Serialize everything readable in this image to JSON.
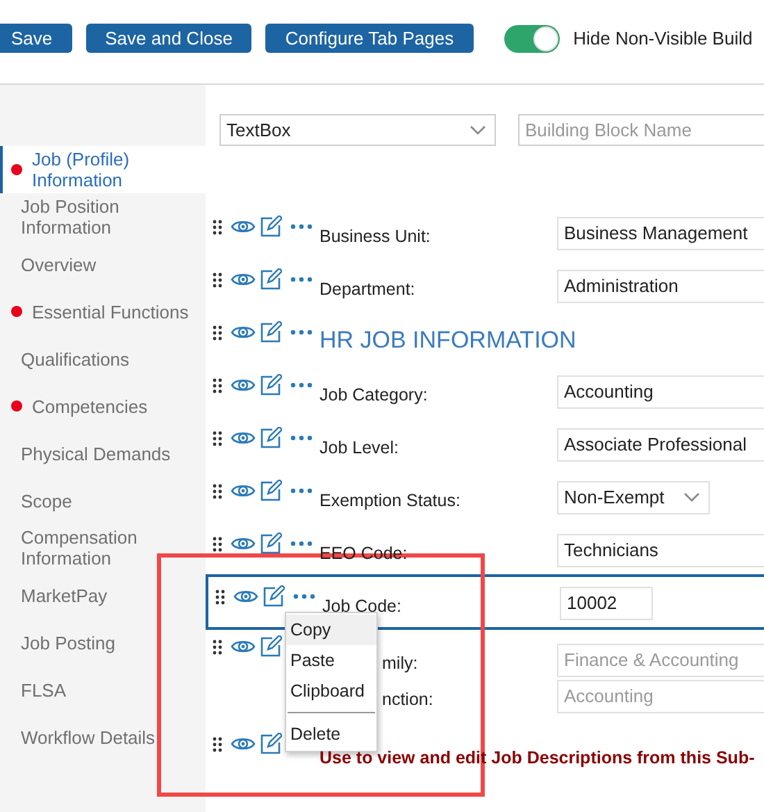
{
  "toolbar": {
    "buttons": [
      "Save",
      "Save and Close",
      "Configure Tab Pages"
    ],
    "toggle": {
      "on": true,
      "label": "Hide Non-Visible Build"
    }
  },
  "sidebar": {
    "items": [
      {
        "label": "Job (Profile) Information",
        "flagged": true,
        "selected": true
      },
      {
        "label": "Job Position Information",
        "flagged": false,
        "selected": false
      },
      {
        "label": "Overview",
        "flagged": false,
        "selected": false
      },
      {
        "label": "Essential Functions",
        "flagged": true,
        "selected": false
      },
      {
        "label": "Qualifications",
        "flagged": false,
        "selected": false
      },
      {
        "label": "Competencies",
        "flagged": true,
        "selected": false
      },
      {
        "label": "Physical Demands",
        "flagged": false,
        "selected": false
      },
      {
        "label": "Scope",
        "flagged": false,
        "selected": false
      },
      {
        "label": "Compensation Information",
        "flagged": false,
        "selected": false
      },
      {
        "label": "MarketPay",
        "flagged": false,
        "selected": false
      },
      {
        "label": "Job Posting",
        "flagged": false,
        "selected": false
      },
      {
        "label": "FLSA",
        "flagged": false,
        "selected": false
      },
      {
        "label": "Workflow Details",
        "flagged": false,
        "selected": false
      }
    ]
  },
  "filters": {
    "type_select": {
      "value": "TextBox"
    },
    "name_field": {
      "placeholder": "Building Block Name"
    }
  },
  "rows": [
    {
      "kind": "field",
      "selected": false,
      "fields": [
        {
          "label": "Business Unit:",
          "value": "Business Management",
          "kind": "textbox",
          "disabled": false
        }
      ]
    },
    {
      "kind": "field",
      "selected": false,
      "fields": [
        {
          "label": "Department:",
          "value": "Administration",
          "kind": "textbox",
          "disabled": false
        }
      ]
    },
    {
      "kind": "heading",
      "selected": false,
      "text": "HR JOB INFORMATION"
    },
    {
      "kind": "field",
      "selected": false,
      "fields": [
        {
          "label": "Job Category:",
          "value": "Accounting",
          "kind": "textbox",
          "disabled": false
        }
      ]
    },
    {
      "kind": "field",
      "selected": false,
      "fields": [
        {
          "label": "Job Level:",
          "value": "Associate Professional",
          "kind": "textbox",
          "disabled": false
        }
      ]
    },
    {
      "kind": "field",
      "selected": false,
      "fields": [
        {
          "label": "Exemption Status:",
          "value": "Non-Exempt",
          "kind": "dropdown",
          "disabled": false
        }
      ]
    },
    {
      "kind": "field",
      "selected": false,
      "fields": [
        {
          "label": "EEO Code:",
          "value": "Technicians",
          "kind": "textbox",
          "disabled": false
        }
      ]
    },
    {
      "kind": "field",
      "selected": true,
      "fields": [
        {
          "label": "Job Code:",
          "value": "10002",
          "kind": "short",
          "disabled": false
        }
      ]
    },
    {
      "kind": "field",
      "selected": false,
      "fields": [
        {
          "label": "mily:",
          "value": "Finance & Accounting",
          "kind": "textbox",
          "disabled": true
        },
        {
          "label": "nction:",
          "value": "Accounting",
          "kind": "textbox",
          "disabled": true
        }
      ]
    },
    {
      "kind": "note",
      "selected": false,
      "text": "Use to view and edit Job Descriptions from this Sub-"
    }
  ],
  "context_menu": {
    "items": [
      {
        "kind": "action",
        "label": "Copy",
        "highlighted": true
      },
      {
        "kind": "action",
        "label": "Paste",
        "highlighted": false
      },
      {
        "kind": "action",
        "label": "Clipboard",
        "highlighted": false
      },
      {
        "kind": "divider"
      },
      {
        "kind": "action",
        "label": "Delete",
        "highlighted": false
      }
    ]
  }
}
